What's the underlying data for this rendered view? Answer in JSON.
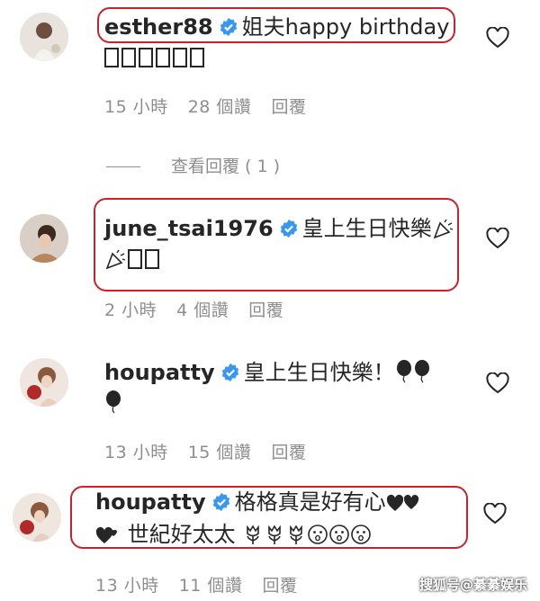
{
  "comments": [
    {
      "username": "esther88",
      "line1": "姐夫happy birthday",
      "line2_boxes": 6,
      "time": "15 小時",
      "likes": "28 個讚",
      "reply": "回覆",
      "view_replies": "查看回覆 ( 1 )"
    },
    {
      "username": "june_tsai1976",
      "line1": "皇上生日快樂",
      "time": "2 小時",
      "likes": "4 個讚",
      "reply": "回覆"
    },
    {
      "username": "houpatty",
      "line1": "皇上生日快樂！",
      "time": "13 小時",
      "likes": "15 個讚",
      "reply": "回覆"
    },
    {
      "username": "houpatty",
      "line1": "格格真是好有心",
      "line2": "世紀好太太",
      "time": "13 小時",
      "likes": "11 個讚",
      "reply": "回覆"
    }
  ],
  "icons": [
    "verified-badge-icon",
    "heart-icon",
    "balloon-icon",
    "party-popper-icon",
    "two-hearts-icon",
    "tulip-icon",
    "astonished-face-icon"
  ],
  "colors": {
    "verified": "#3897f0",
    "highlight": "#c8232c",
    "meta": "#8e8e8e"
  },
  "watermark": "搜狐号@綦綦娱乐"
}
